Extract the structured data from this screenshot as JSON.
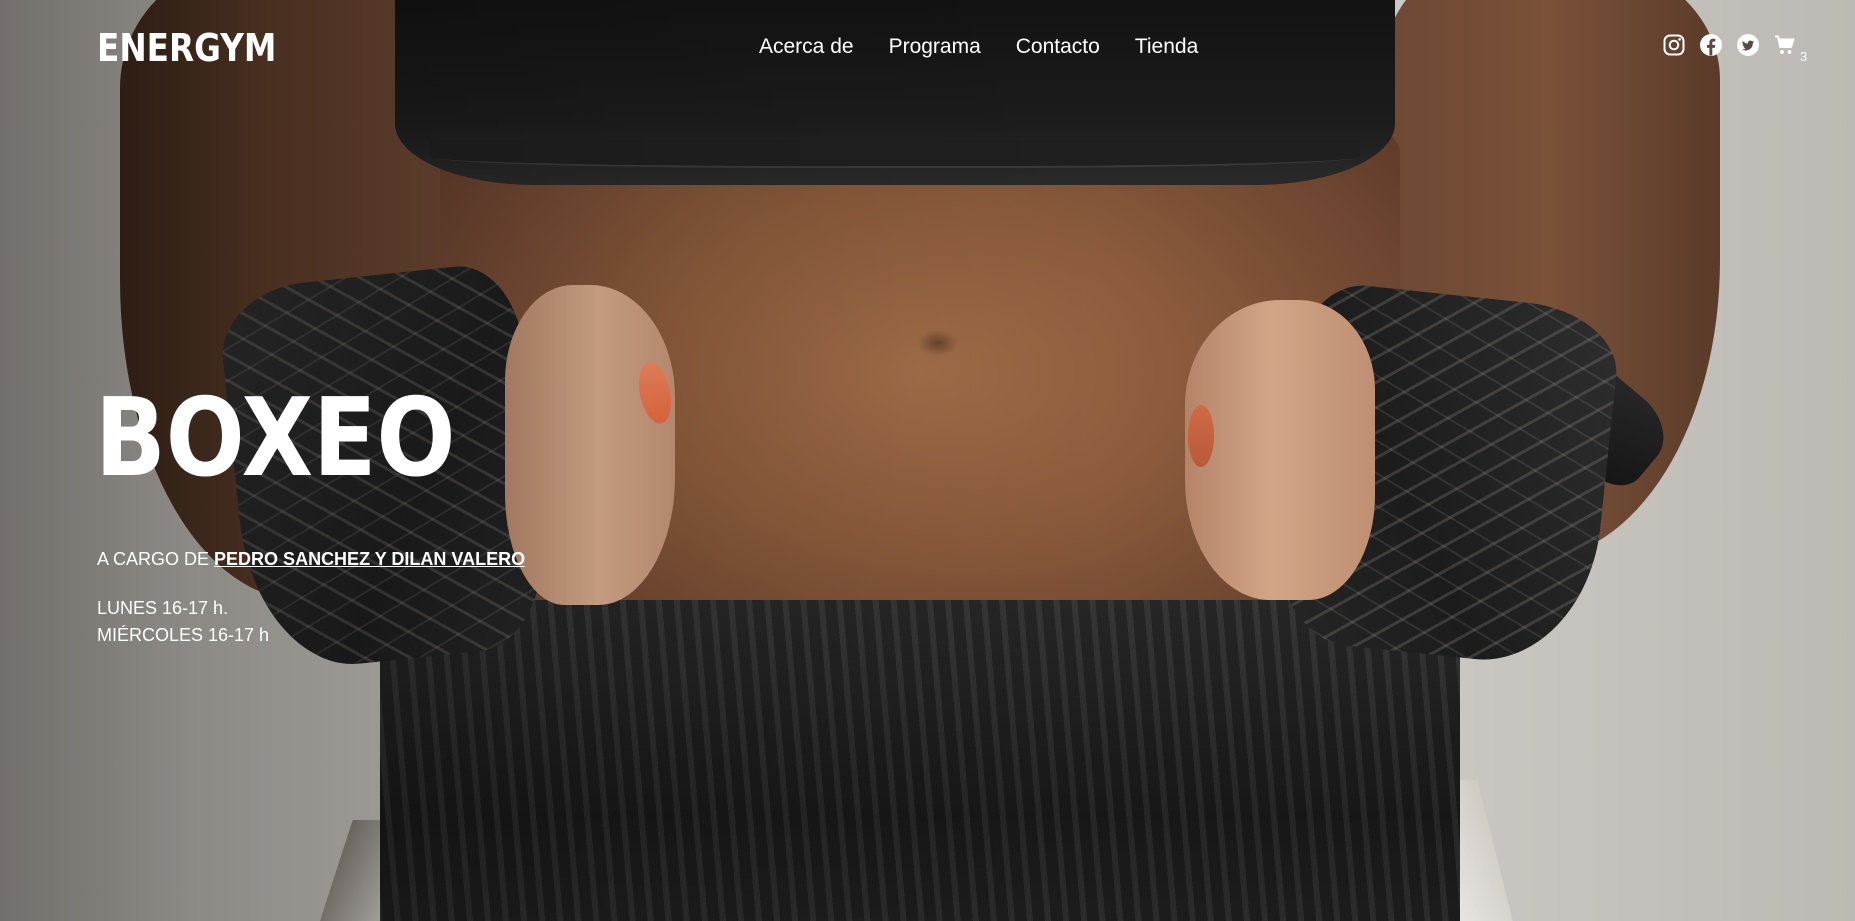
{
  "header": {
    "logo": "ENERGYM",
    "nav": [
      "Acerca de",
      "Programa",
      "Contacto",
      "Tienda"
    ],
    "social_icons": [
      "instagram-icon",
      "facebook-icon",
      "twitter-icon"
    ],
    "cart": {
      "icon": "cart-icon",
      "count": "3"
    }
  },
  "hero": {
    "title": "BOXEO",
    "trainer_prefix": "A CARGO DE",
    "trainer_names": "PEDRO SANCHEZ Y DILAN VALERO",
    "schedule": [
      "LUNES 16-17 h.",
      "MIÉRCOLES 16-17 h"
    ]
  },
  "colors": {
    "text": "#ffffff",
    "nail_accent": "#e46a42"
  }
}
